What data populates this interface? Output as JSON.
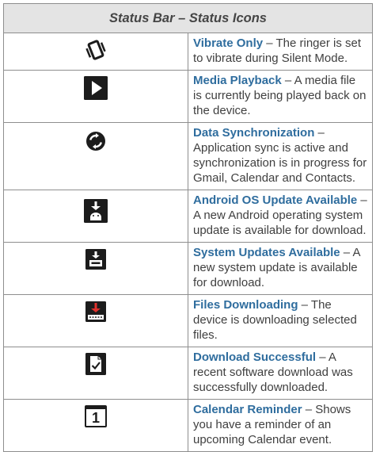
{
  "table": {
    "title": "Status Bar – Status Icons",
    "rows": [
      {
        "icon": "vibrate-icon",
        "name": "Vibrate Only",
        "sep": " – ",
        "desc": "The ringer is set to vibrate during Silent Mode."
      },
      {
        "icon": "play-icon",
        "name": "Media Playback",
        "sep": " – ",
        "desc": "A media file is currently being played back on the device."
      },
      {
        "icon": "sync-icon",
        "name": "Data Synchronization",
        "sep": " – ",
        "desc": "Application sync is active and synchronization is in progress for Gmail, Calendar and Contacts."
      },
      {
        "icon": "android-update-icon",
        "name": "Android OS Update Available",
        "sep": " – ",
        "desc": "A new Android operating system update is available for download."
      },
      {
        "icon": "system-update-icon",
        "name": "System Updates Available",
        "sep": " – ",
        "desc": "A new system update is available for download."
      },
      {
        "icon": "download-icon",
        "name": "Files Downloading",
        "sep": " – ",
        "desc": "The device is downloading selected files."
      },
      {
        "icon": "download-success-icon",
        "name": "Download Successful",
        "sep": " – ",
        "desc": "A recent software download was successfully downloaded."
      },
      {
        "icon": "calendar-icon",
        "name": "Calendar Reminder",
        "sep": " – ",
        "desc": "Shows you have a reminder of an upcoming Calendar event.",
        "icon_text": "1"
      }
    ]
  },
  "colors": {
    "name": "#2f6d9e",
    "header_bg": "#e4e4e4",
    "icon_dark": "#1c1c1c",
    "icon_red": "#e0312c"
  }
}
